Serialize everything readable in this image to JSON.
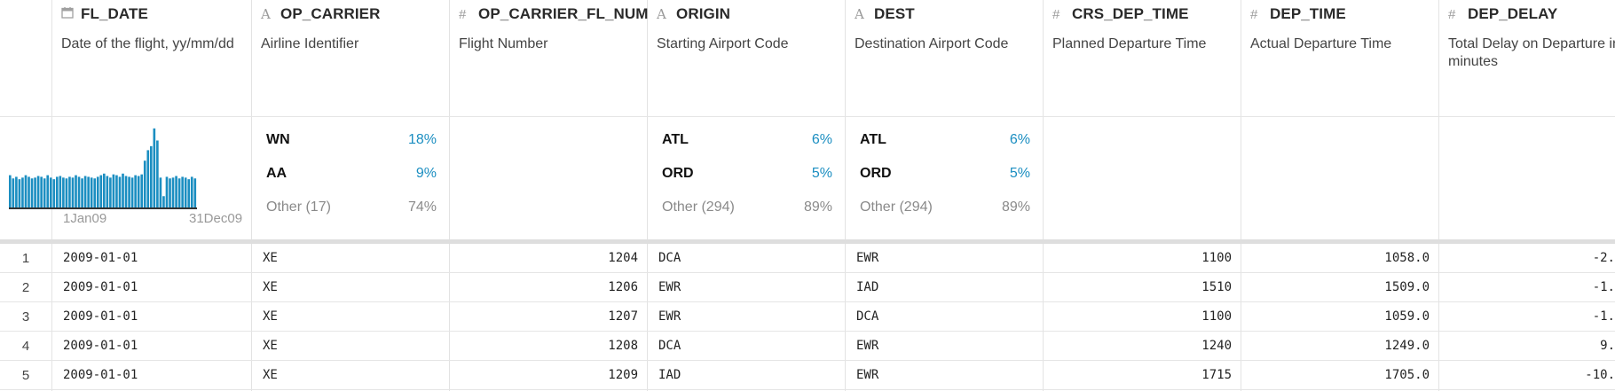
{
  "columns": [
    {
      "name": "FL_DATE",
      "type_icon": "calendar-icon",
      "description": "Date of the flight, yy/mm/dd"
    },
    {
      "name": "OP_CARRIER",
      "type_icon": "text-type-icon",
      "description": "Airline Identifier"
    },
    {
      "name": "OP_CARRIER_FL_NUM",
      "type_icon": "number-type-icon",
      "description": "Flight Number"
    },
    {
      "name": "ORIGIN",
      "type_icon": "text-type-icon",
      "description": "Starting Airport Code"
    },
    {
      "name": "DEST",
      "type_icon": "text-type-icon",
      "description": "Destination Airport Code"
    },
    {
      "name": "CRS_DEP_TIME",
      "type_icon": "number-type-icon",
      "description": "Planned Departure Time"
    },
    {
      "name": "DEP_TIME",
      "type_icon": "number-type-icon",
      "description": "Actual Departure Time"
    },
    {
      "name": "DEP_DELAY",
      "type_icon": "number-type-icon",
      "description": "Total Delay on Departure in minutes"
    }
  ],
  "fl_date_histogram": {
    "start_label": "1Jan09",
    "end_label": "31Dec09",
    "accent_color": "#1b8ec1",
    "relative_heights": [
      0.4,
      0.36,
      0.38,
      0.35,
      0.37,
      0.4,
      0.38,
      0.36,
      0.37,
      0.39,
      0.38,
      0.36,
      0.4,
      0.37,
      0.35,
      0.38,
      0.39,
      0.37,
      0.36,
      0.38,
      0.37,
      0.4,
      0.38,
      0.36,
      0.39,
      0.38,
      0.37,
      0.36,
      0.38,
      0.4,
      0.42,
      0.39,
      0.37,
      0.41,
      0.4,
      0.38,
      0.42,
      0.39,
      0.38,
      0.37,
      0.4,
      0.39,
      0.41,
      0.58,
      0.71,
      0.76,
      0.98,
      0.83,
      0.37,
      0.14,
      0.38,
      0.36,
      0.37,
      0.39,
      0.36,
      0.38,
      0.37,
      0.35,
      0.38,
      0.36
    ]
  },
  "stats": {
    "OP_CARRIER": [
      {
        "k": "WN",
        "v": "18%"
      },
      {
        "k": "AA",
        "v": "9%"
      },
      {
        "k": "Other (17)",
        "v": "74%"
      }
    ],
    "ORIGIN": [
      {
        "k": "ATL",
        "v": "6%"
      },
      {
        "k": "ORD",
        "v": "5%"
      },
      {
        "k": "Other (294)",
        "v": "89%"
      }
    ],
    "DEST": [
      {
        "k": "ATL",
        "v": "6%"
      },
      {
        "k": "ORD",
        "v": "5%"
      },
      {
        "k": "Other (294)",
        "v": "89%"
      }
    ]
  },
  "rows": [
    {
      "n": "1",
      "cells": [
        "2009-01-01",
        "XE",
        "1204",
        "DCA",
        "EWR",
        "1100",
        "1058.0",
        "-2."
      ]
    },
    {
      "n": "2",
      "cells": [
        "2009-01-01",
        "XE",
        "1206",
        "EWR",
        "IAD",
        "1510",
        "1509.0",
        "-1."
      ]
    },
    {
      "n": "3",
      "cells": [
        "2009-01-01",
        "XE",
        "1207",
        "EWR",
        "DCA",
        "1100",
        "1059.0",
        "-1."
      ]
    },
    {
      "n": "4",
      "cells": [
        "2009-01-01",
        "XE",
        "1208",
        "DCA",
        "EWR",
        "1240",
        "1249.0",
        "9."
      ]
    },
    {
      "n": "5",
      "cells": [
        "2009-01-01",
        "XE",
        "1209",
        "IAD",
        "EWR",
        "1715",
        "1705.0",
        "-10."
      ]
    }
  ]
}
